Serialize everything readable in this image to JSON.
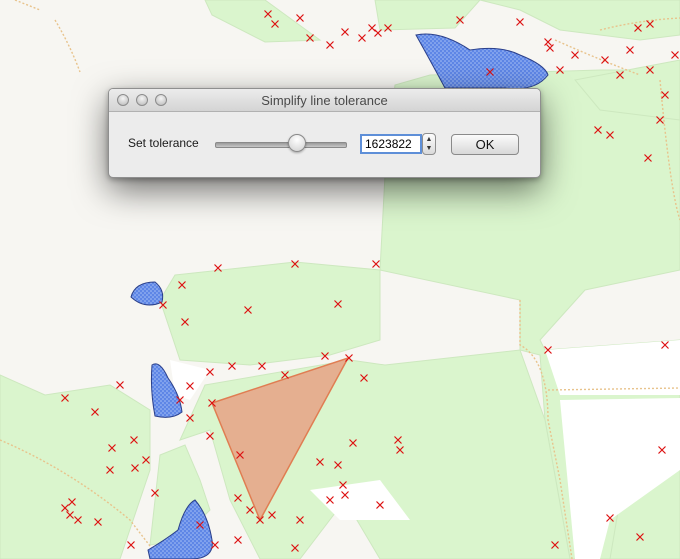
{
  "dialog": {
    "title": "Simplify line tolerance",
    "tolerance_label": "Set tolerance",
    "tolerance_value": "1623822",
    "slider_fraction": 0.63,
    "ok_label": "OK",
    "stepper_up": "▲",
    "stepper_down": "▼"
  },
  "map": {
    "colors": {
      "background": "#f7f6f2",
      "grassland": "#daf5cd",
      "water": "#5e86e6",
      "selected_polygon": "#e5a78a",
      "vertex_marker": "#dd1111",
      "path": "#e8c38c"
    }
  }
}
